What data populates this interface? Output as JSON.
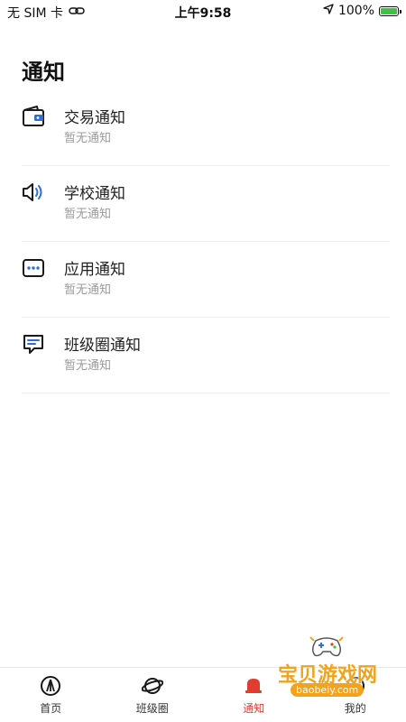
{
  "status_bar": {
    "carrier": "无 SIM 卡",
    "time": "上午9:58",
    "battery": "100%",
    "battery_level": 1.0
  },
  "page": {
    "title": "通知"
  },
  "notifications": [
    {
      "icon": "wallet-icon",
      "title": "交易通知",
      "subtitle": "暂无通知"
    },
    {
      "icon": "speaker-icon",
      "title": "学校通知",
      "subtitle": "暂无通知"
    },
    {
      "icon": "app-dots-icon",
      "title": "应用通知",
      "subtitle": "暂无通知"
    },
    {
      "icon": "chat-bubble-icon",
      "title": "班级圈通知",
      "subtitle": "暂无通知"
    }
  ],
  "tab_bar": {
    "tabs": [
      {
        "label": "首页",
        "icon": "home-icon",
        "active": false
      },
      {
        "label": "班级圈",
        "icon": "planet-icon",
        "active": false
      },
      {
        "label": "通知",
        "icon": "bell-icon",
        "active": true
      },
      {
        "label": "我的",
        "icon": "profile-icon",
        "active": false
      }
    ]
  },
  "watermark": {
    "title": "宝贝游戏网",
    "url": "baobeiy.com"
  },
  "colors": {
    "accent_red": "#e23b2f",
    "icon_blue": "#2f6fd6",
    "battery_green": "#3cc441",
    "watermark_orange": "#f3a21b"
  }
}
